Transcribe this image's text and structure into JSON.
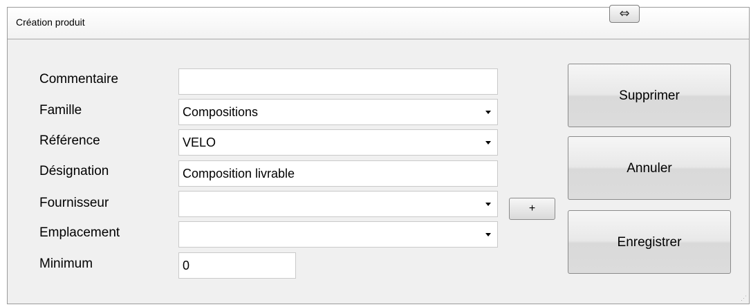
{
  "window": {
    "title": "Création produit",
    "resize_icon": "⇔"
  },
  "form": {
    "commentaire": {
      "label": "Commentaire",
      "value": ""
    },
    "famille": {
      "label": "Famille",
      "value": "Compositions"
    },
    "reference": {
      "label": "Référence",
      "value": "VELO"
    },
    "designation": {
      "label": "Désignation",
      "value": "Composition livrable"
    },
    "fournisseur": {
      "label": "Fournisseur",
      "value": ""
    },
    "emplacement": {
      "label": "Emplacement",
      "value": ""
    },
    "minimum": {
      "label": "Minimum",
      "value": "0"
    }
  },
  "buttons": {
    "supprimer": "Supprimer",
    "annuler": "Annuler",
    "enregistrer": "Enregistrer",
    "add": "+"
  }
}
